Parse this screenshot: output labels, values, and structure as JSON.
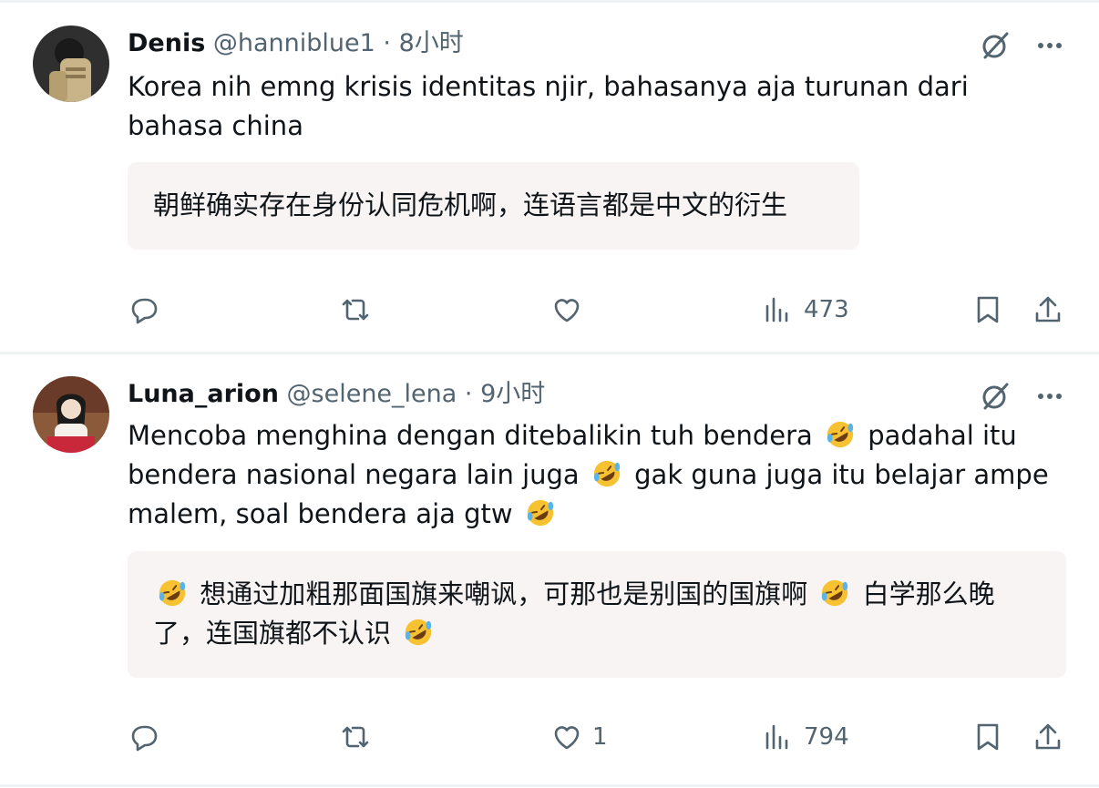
{
  "posts": [
    {
      "name": "Denis",
      "handle": "@hanniblue1",
      "separator": "·",
      "time": "8小时",
      "text": "Korea nih emng krisis identitas njir, bahasanya aja turunan dari bahasa china",
      "translation": "朝鲜确实存在身份认同危机啊，连语言都是中文的衍生",
      "actions": {
        "reply_count": "",
        "repost_count": "",
        "like_count": "",
        "view_count": "473"
      },
      "avatar_colors": [
        "#3a3a3a",
        "#c9b48a"
      ]
    },
    {
      "name": "Luna_arion",
      "handle": "@selene_lena",
      "separator": "·",
      "time": "9小时",
      "text_parts": [
        "Mencoba menghina dengan ditebalikin tuh bendera",
        "padahal itu bendera nasional negara lain juga",
        "gak guna juga itu belajar ampe malem, soal bendera aja gtw"
      ],
      "translation_parts": [
        "想通过加粗那面国旗来嘲讽，可那也是别国的国旗啊",
        "白学那么晚了，连国旗都不认识"
      ],
      "emoji": "rolling-on-floor-laughing",
      "actions": {
        "reply_count": "",
        "repost_count": "",
        "like_count": "1",
        "view_count": "794"
      },
      "avatar_colors": [
        "#7a3b2e",
        "#e8d6c8"
      ]
    }
  ],
  "colors": {
    "text": "#0f1419",
    "secondary": "#536471",
    "divider": "#eff3f4",
    "translation_bg": "#f7f4f3"
  }
}
